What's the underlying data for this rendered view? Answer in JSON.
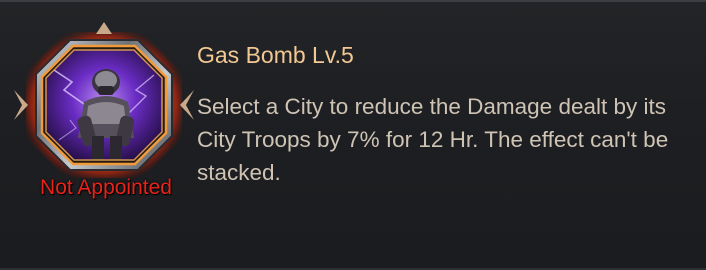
{
  "skill": {
    "name": "Gas Bomb Lv.5",
    "description": "Select a City to reduce the Damage dealt by its City Troops by 7% for 12 Hr. The effect can't be stacked.",
    "status": "Not Appointed",
    "icon": "soldier-portrait-icon"
  },
  "colors": {
    "title": "#f2c894",
    "description": "#cfc3b4",
    "status": "#e8231b",
    "frame_glow": "#e4571c",
    "portrait_aura": "#7a3bd6"
  }
}
